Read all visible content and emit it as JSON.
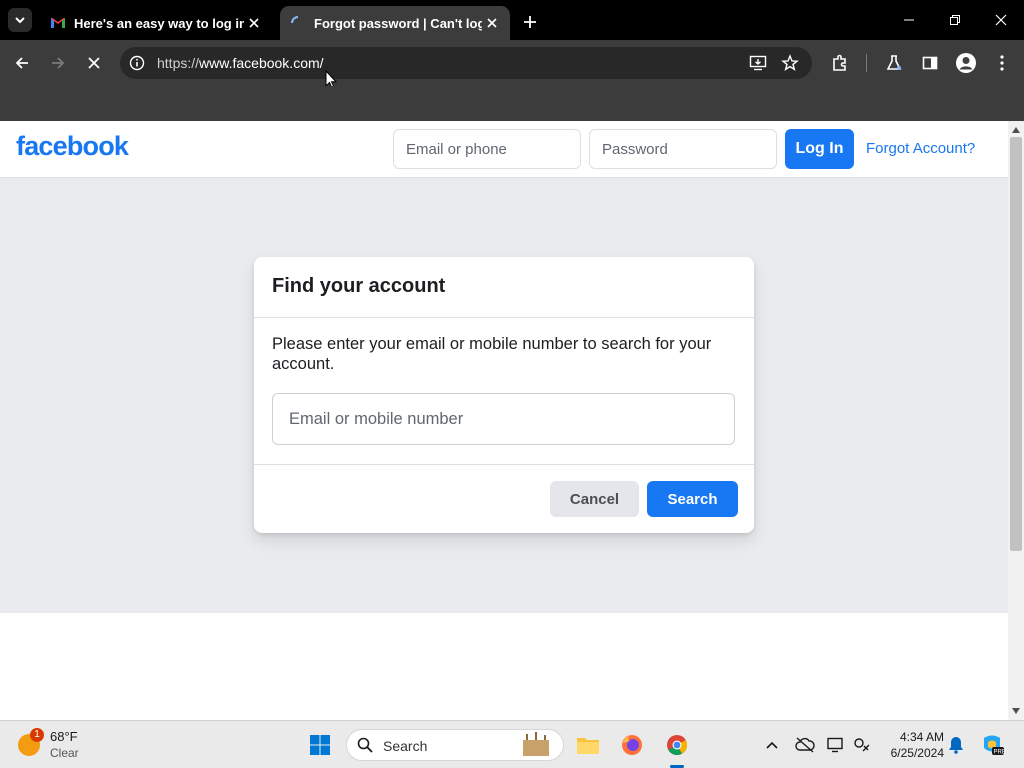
{
  "browser": {
    "tabs": [
      {
        "title": "Here's an easy way to log into",
        "active": false,
        "favicon": "gmail-icon"
      },
      {
        "title": "Forgot password | Can't log in",
        "active": true,
        "favicon": "loading-icon"
      }
    ],
    "url_prefix": "https://",
    "url_host": "www.facebook.com",
    "url_path": "/"
  },
  "facebook": {
    "logo": "facebook",
    "header": {
      "email_placeholder": "Email or phone",
      "password_placeholder": "Password",
      "login_label": "Log In",
      "forgot_label": "Forgot Account?"
    },
    "card": {
      "title": "Find your account",
      "description": "Please enter your email or mobile number to search for your account.",
      "input_placeholder": "Email or mobile number",
      "cancel_label": "Cancel",
      "search_label": "Search"
    }
  },
  "taskbar": {
    "weather_temp": "68°F",
    "weather_condition": "Clear",
    "weather_badge": "1",
    "search_label": "Search",
    "time": "4:34 AM",
    "date": "6/25/2024"
  },
  "colors": {
    "brand": "#1877f2",
    "page_bg": "#e9ebee",
    "chrome_dark": "#3c3c3c"
  }
}
